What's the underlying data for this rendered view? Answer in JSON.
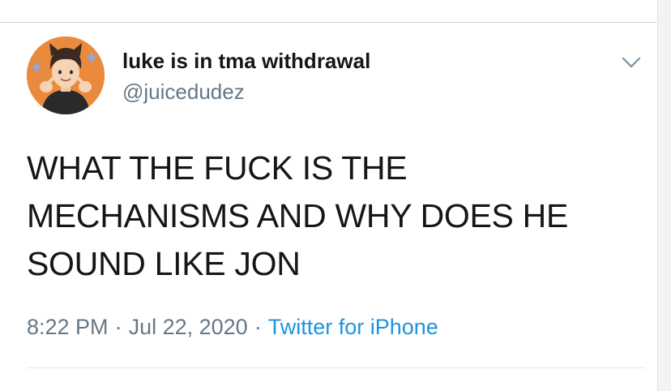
{
  "tweet": {
    "display_name": "luke is in tma withdrawal",
    "handle": "@juicedudez",
    "text": "WHAT THE FUCK IS THE\nMECHANISMS AND WHY DOES HE\nSOUND LIKE JON",
    "time": "8:22 PM",
    "separator": "·",
    "date": "Jul 22, 2020",
    "source": "Twitter for iPhone",
    "menu_icon": "chevron-down-icon",
    "avatar_icon": "cartoon-avatar"
  },
  "colors": {
    "text_primary": "#14171a",
    "text_secondary": "#657786",
    "link": "#1b95e0",
    "avatar_background": "#e98a3c"
  }
}
